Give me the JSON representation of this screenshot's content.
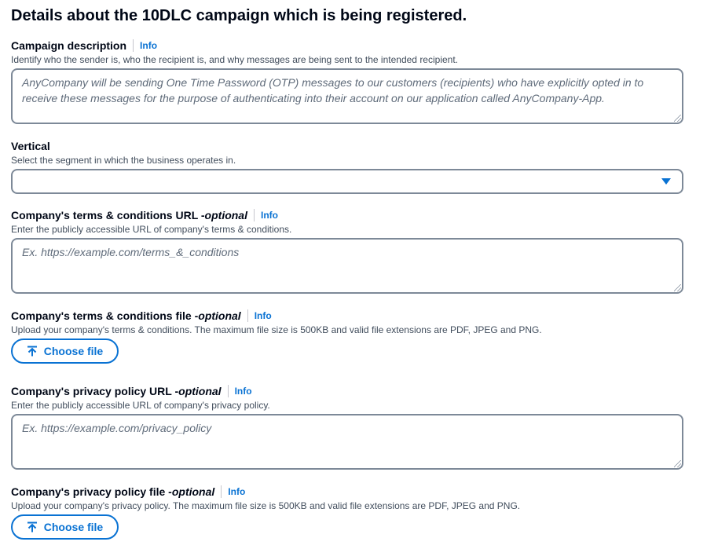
{
  "heading": "Details about the 10DLC campaign which is being registered.",
  "info_label": "Info",
  "campaign_description": {
    "label": "Campaign description",
    "description": "Identify who the sender is, who the recipient is, and why messages are being sent to the intended recipient.",
    "value": "AnyCompany will be sending One Time Password (OTP) messages to our customers (recipients) who have explicitly opted in to receive these messages for the purpose of authenticating into their account on our application called AnyCompany-App."
  },
  "vertical": {
    "label": "Vertical",
    "description": "Select the segment in which the business operates in.",
    "selected": ""
  },
  "terms_url": {
    "label": "Company's terms & conditions URL - ",
    "optional": "optional",
    "description": "Enter the publicly accessible URL of company's terms & conditions.",
    "placeholder": "Ex. https://example.com/terms_&_conditions"
  },
  "terms_file": {
    "label": "Company's terms & conditions file - ",
    "optional": "optional",
    "description": "Upload your company's terms & conditions. The maximum file size is 500KB and valid file extensions are PDF, JPEG and PNG.",
    "button": "Choose file"
  },
  "privacy_url": {
    "label": "Company's privacy policy URL - ",
    "optional": "optional",
    "description": "Enter the publicly accessible URL of company's privacy policy.",
    "placeholder": "Ex. https://example.com/privacy_policy"
  },
  "privacy_file": {
    "label": "Company's privacy policy file - ",
    "optional": "optional",
    "description": "Upload your company's privacy policy. The maximum file size is 500KB and valid file extensions are PDF, JPEG and PNG.",
    "button": "Choose file"
  },
  "colors": {
    "link": "#0972d3",
    "border": "#7d8998",
    "text": "#000716",
    "secondary_text": "#414d5c"
  },
  "icons": {
    "upload": "upload-icon",
    "dropdown": "caret-down-icon",
    "resize": "resize-handle-icon"
  }
}
